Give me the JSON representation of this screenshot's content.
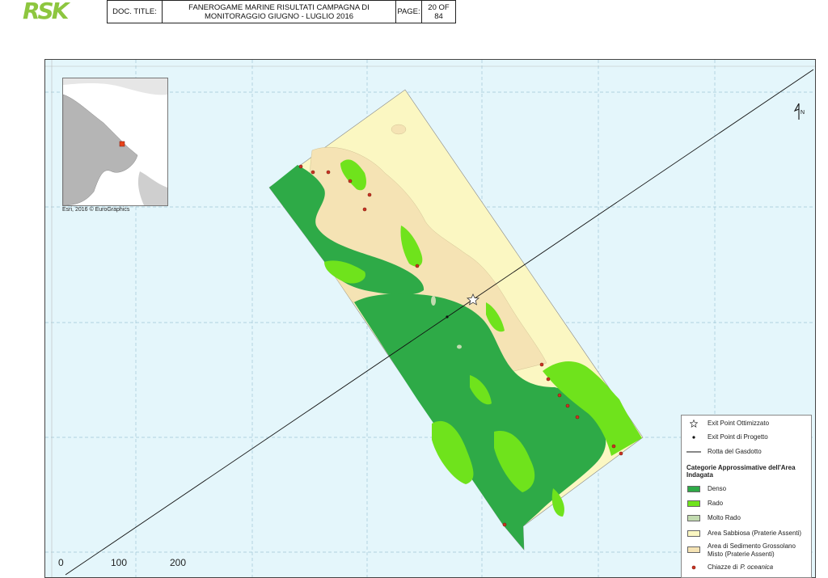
{
  "header": {
    "logo": "RSK",
    "doc_title_label": "DOC. TITLE:",
    "doc_title_line1": "FANEROGAME MARINE RISULTATI CAMPAGNA DI",
    "doc_title_line2": "MONITORAGGIO GIUGNO - LUGLIO 2016",
    "page_label": "PAGE:",
    "page_line1": "20 OF",
    "page_line2": "84"
  },
  "map": {
    "inset_credit": "Esri, 2016 © EuroGraphics",
    "north_label": "N",
    "colors": {
      "water": "#e4f6fb",
      "denso": "#2eaa47",
      "rado": "#6fe31c",
      "molto_rado": "#c2dbb0",
      "sabbiosa": "#fbf7c2",
      "grossolano": "#f5e3b4",
      "chiazze": "#cc3322"
    }
  },
  "legend": {
    "exit_ottimizzato": "Exit Point Ottimizzato",
    "exit_progetto": "Exit Point di Progetto",
    "rotta": "Rotta del Gasdotto",
    "categorie_title": "Categorie Approssimative dell'Area Indagata",
    "denso": "Denso",
    "rado": "Rado",
    "molto_rado": "Molto Rado",
    "sabbiosa": "Area Sabbiosa (Praterie Assenti)",
    "grossolano_1": "Area di Sedimento Grossolano",
    "grossolano_2": "Misto (Praterie Assenti)",
    "chiazze_prefix": "Chiazze di ",
    "chiazze_species": "P. oceanica"
  },
  "scale": {
    "t0": "0",
    "t1": "100",
    "t2": "200"
  }
}
